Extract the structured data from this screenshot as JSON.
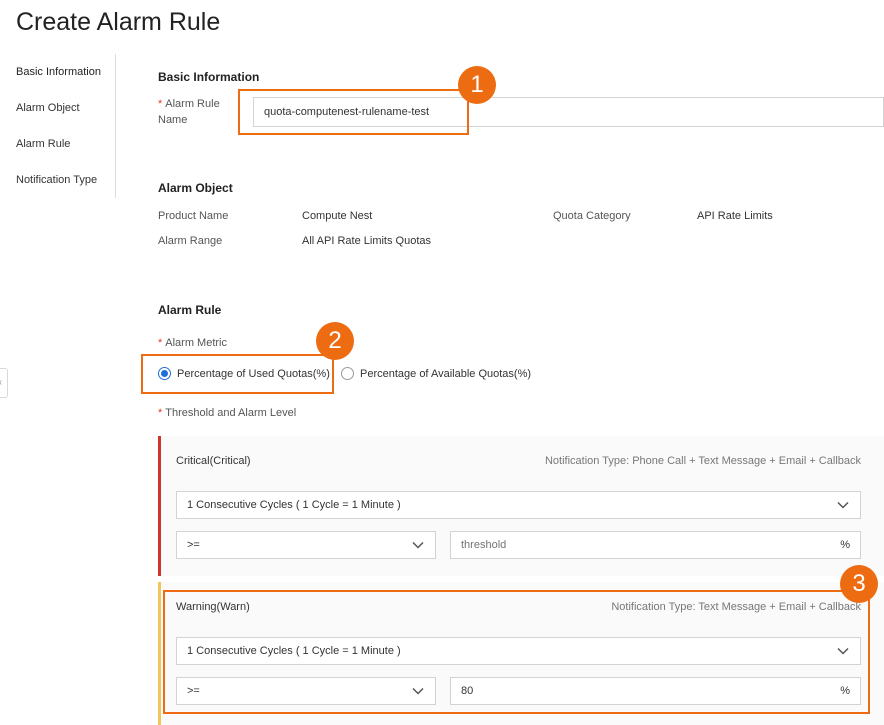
{
  "page": {
    "title": "Create Alarm Rule"
  },
  "side_nav": {
    "items": [
      {
        "label": "Basic Information"
      },
      {
        "label": "Alarm Object"
      },
      {
        "label": "Alarm Rule"
      },
      {
        "label": "Notification Type"
      }
    ]
  },
  "basic_info": {
    "title": "Basic Information",
    "rule_name_label_line1": "Alarm Rule",
    "rule_name_label_line2": "Name",
    "rule_name_value": "quota-computenest-rulename-test"
  },
  "alarm_object": {
    "title": "Alarm Object",
    "product_name_label": "Product Name",
    "product_name_value": "Compute Nest",
    "quota_category_label": "Quota Category",
    "quota_category_value": "API Rate Limits",
    "alarm_range_label": "Alarm Range",
    "alarm_range_value": "All API Rate Limits Quotas"
  },
  "alarm_rule": {
    "title": "Alarm Rule",
    "metric_label": "Alarm Metric",
    "metric_options": [
      {
        "label": "Percentage of Used Quotas(%)",
        "checked": true
      },
      {
        "label": "Percentage of Available Quotas(%)",
        "checked": false
      }
    ],
    "threshold_label": "Threshold and Alarm Level",
    "levels": [
      {
        "name": "Critical(Critical)",
        "notification": "Notification Type: Phone Call + Text Message + Email + Callback",
        "cycles": "1 Consecutive Cycles ( 1 Cycle = 1 Minute )",
        "operator": ">=",
        "threshold_value": "",
        "threshold_placeholder": "threshold",
        "unit": "%",
        "color": "#d0342c"
      },
      {
        "name": "Warning(Warn)",
        "notification": "Notification Type: Text Message + Email + Callback",
        "cycles": "1 Consecutive Cycles ( 1 Cycle = 1 Minute )",
        "operator": ">=",
        "threshold_value": "80",
        "threshold_placeholder": "threshold",
        "unit": "%",
        "color": "#f1c75b"
      }
    ]
  },
  "callouts": [
    "1",
    "2",
    "3"
  ],
  "colors": {
    "callout": "#ed6b11",
    "accent": "#1f6fd6",
    "required": "#e3401c"
  },
  "icons": {
    "chevron": "chevron-down-icon",
    "collapse": "chevron-left-icon"
  }
}
